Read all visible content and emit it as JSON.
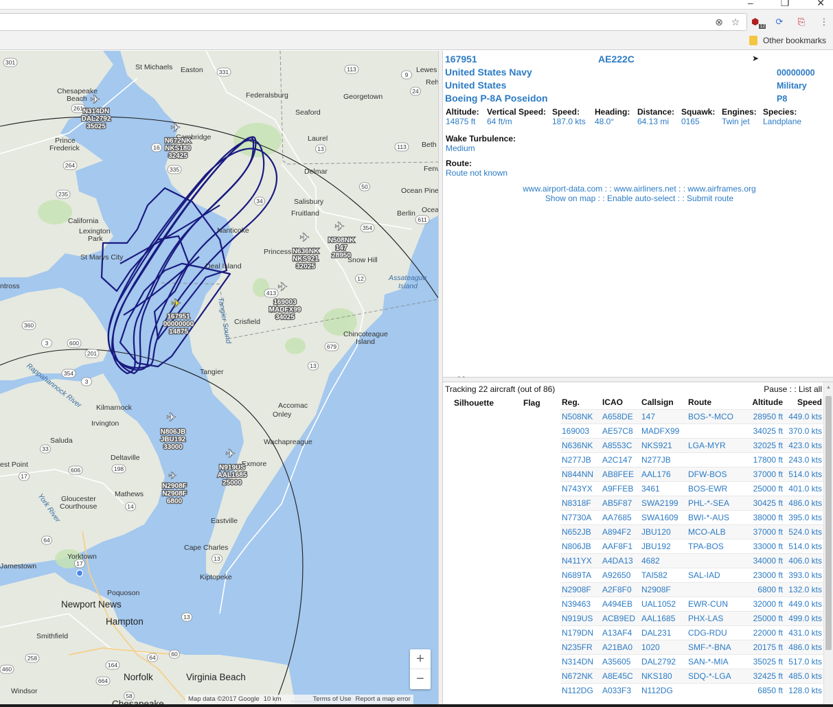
{
  "browser": {
    "other_bookmarks": "Other bookmarks",
    "ext_badge": "12",
    "window_buttons": [
      "–",
      "❐",
      "✕"
    ]
  },
  "aircraft": {
    "reg": "167951",
    "icao": "AE222C",
    "operator": "United States Navy",
    "squawk_code": "00000000",
    "country": "United States",
    "category": "Military",
    "type": "Boeing P-8A Poseidon",
    "type_code": "P8",
    "stats": [
      {
        "k": "Altitude:",
        "v": "14875 ft"
      },
      {
        "k": "Vertical Speed:",
        "v": "64 ft/m"
      },
      {
        "k": "Speed:",
        "v": "187.0 kts"
      },
      {
        "k": "Heading:",
        "v": "48.0°"
      },
      {
        "k": "Distance:",
        "v": "64.13 mi"
      },
      {
        "k": "Squawk:",
        "v": "0165"
      },
      {
        "k": "Engines:",
        "v": "Twin jet"
      },
      {
        "k": "Species:",
        "v": "Landplane"
      }
    ],
    "wake_label": "Wake Turbulence:",
    "wake_value": "Medium",
    "route_label": "Route:",
    "route_value": "Route not known",
    "links1": [
      "www.airport-data.com",
      "www.airliners.net",
      "www.airframes.org"
    ],
    "links2": [
      "Show on map",
      "Enable auto-select",
      "Submit route"
    ],
    "sep": " : : "
  },
  "tracking": {
    "summary": "Tracking 22 aircraft (out of 86)",
    "pause": "Pause",
    "list_all": "List all",
    "columns": [
      "Silhouette",
      "Flag",
      "Reg.",
      "ICAO",
      "Callsign",
      "Route",
      "Altitude",
      "Speed"
    ],
    "rows": [
      [
        "N508NK",
        "A658DE",
        "147",
        "BOS-*-MCO",
        "28950 ft",
        "449.0 kts"
      ],
      [
        "169003",
        "AE57C8",
        "MADFX99",
        "",
        "34025 ft",
        "370.0 kts"
      ],
      [
        "N636NK",
        "A8553C",
        "NKS921",
        "LGA-MYR",
        "32025 ft",
        "423.0 kts"
      ],
      [
        "N277JB",
        "A2C147",
        "N277JB",
        "",
        "17800 ft",
        "243.0 kts"
      ],
      [
        "N844NN",
        "AB8FEE",
        "AAL176",
        "DFW-BOS",
        "37000 ft",
        "514.0 kts"
      ],
      [
        "N743YX",
        "A9FFEB",
        "3461",
        "BOS-EWR",
        "25000 ft",
        "401.0 kts"
      ],
      [
        "N8318F",
        "AB5F87",
        "SWA2199",
        "PHL-*-SEA",
        "30425 ft",
        "486.0 kts"
      ],
      [
        "N7730A",
        "AA7685",
        "SWA1609",
        "BWI-*-AUS",
        "38000 ft",
        "395.0 kts"
      ],
      [
        "N652JB",
        "A894F2",
        "JBU120",
        "MCO-ALB",
        "37000 ft",
        "524.0 kts"
      ],
      [
        "N806JB",
        "AAF8F1",
        "JBU192",
        "TPA-BOS",
        "33000 ft",
        "514.0 kts"
      ],
      [
        "N411YX",
        "A4DA13",
        "4682",
        "",
        "34000 ft",
        "406.0 kts"
      ],
      [
        "N689TA",
        "A92650",
        "TAI582",
        "SAL-IAD",
        "23000 ft",
        "393.0 kts"
      ],
      [
        "N2908F",
        "A2F8F0",
        "N2908F",
        "",
        "6800 ft",
        "132.0 kts"
      ],
      [
        "N39463",
        "A494EB",
        "UAL1052",
        "EWR-CUN",
        "32000 ft",
        "449.0 kts"
      ],
      [
        "N919US",
        "ACB9ED",
        "AAL1685",
        "PHX-LAS",
        "25000 ft",
        "499.0 kts"
      ],
      [
        "N179DN",
        "A13AF4",
        "DAL231",
        "CDG-RDU",
        "22000 ft",
        "431.0 kts"
      ],
      [
        "N235FR",
        "A21BA0",
        "1020",
        "SMF-*-BNA",
        "20175 ft",
        "486.0 kts"
      ],
      [
        "N314DN",
        "A35605",
        "DAL2792",
        "SAN-*-MIA",
        "35025 ft",
        "517.0 kts"
      ],
      [
        "N672NK",
        "A8E45C",
        "NKS180",
        "SDQ-*-LGA",
        "32425 ft",
        "485.0 kts"
      ],
      [
        "N112DG",
        "A033F3",
        "N112DG",
        "",
        "6850 ft",
        "128.0 kts"
      ]
    ]
  },
  "map": {
    "places": [
      {
        "t": "St Michaels"
      },
      {
        "t": "Easton"
      },
      {
        "t": "Chesapeake"
      },
      {
        "t": "Beach"
      },
      {
        "t": "Federalsburg"
      },
      {
        "t": "Georgetown"
      },
      {
        "t": "Seaford"
      },
      {
        "t": "Laurel"
      },
      {
        "t": "Delmar"
      },
      {
        "t": "Salisbury"
      },
      {
        "t": "Fruitland"
      },
      {
        "t": "Berlin"
      },
      {
        "t": "Ocean Pine"
      },
      {
        "t": "Prince"
      },
      {
        "t": "Frederick"
      },
      {
        "t": "California"
      },
      {
        "t": "Lexington"
      },
      {
        "t": "Park"
      },
      {
        "t": "St Marys City"
      },
      {
        "t": "Princess Anne"
      },
      {
        "t": "Nanticoke"
      },
      {
        "t": "Deal Island"
      },
      {
        "t": "Snow Hill"
      },
      {
        "t": "Crisfield"
      },
      {
        "t": "Tangier"
      },
      {
        "t": "Chincoteague"
      },
      {
        "t": "Island"
      },
      {
        "t": "Kilmarnock"
      },
      {
        "t": "Irvington"
      },
      {
        "t": "Saluda"
      },
      {
        "t": "Deltaville"
      },
      {
        "t": "Accomac"
      },
      {
        "t": "Onley"
      },
      {
        "t": "Wachapreague"
      },
      {
        "t": "Exmore"
      },
      {
        "t": "Mathews"
      },
      {
        "t": "Gloucester"
      },
      {
        "t": "Courthouse"
      },
      {
        "t": "Eastville"
      },
      {
        "t": "Cape Charles"
      },
      {
        "t": "Kiptopeke"
      },
      {
        "t": "Yorktown"
      },
      {
        "t": "Jamestown"
      },
      {
        "t": "Poquoson"
      },
      {
        "t": "Newport News"
      },
      {
        "t": "Hampton"
      },
      {
        "t": "Smithfield"
      },
      {
        "t": "Norfolk"
      },
      {
        "t": "Virginia Beach"
      },
      {
        "t": "Windsor"
      },
      {
        "t": "Chesapeake"
      },
      {
        "t": "ntross"
      },
      {
        "t": "est Point"
      },
      {
        "t": "Cambridge"
      },
      {
        "t": "Lewes"
      },
      {
        "t": "Beth"
      },
      {
        "t": "Fenv"
      },
      {
        "t": "Ocea"
      },
      {
        "t": "Reh"
      }
    ],
    "water": [
      "Assateague",
      "Island",
      "Rappahannock River",
      "York River",
      "Tangier Sound"
    ],
    "aircraft_labels": [
      [
        "N314DN",
        "DAL2792",
        "35025"
      ],
      [
        "N672NK",
        "NKS180",
        "32425"
      ],
      [
        "N508NK",
        "147",
        "28950"
      ],
      [
        "N636NK",
        "NKS921",
        "32025"
      ],
      [
        "169003",
        "MADFX99",
        "34025"
      ],
      [
        "167951",
        "00000000",
        "14875"
      ],
      [
        "N806JB",
        "JBU192",
        "33000"
      ],
      [
        "N919US",
        "AAL1685",
        "25000"
      ],
      [
        "N2908F",
        "N2908F",
        "6800"
      ]
    ],
    "shields": [
      "301",
      "331",
      "113",
      "9",
      "24",
      "261",
      "16",
      "335",
      "13",
      "113",
      "264",
      "235",
      "50",
      "34",
      "611",
      "354",
      "12",
      "413",
      "679",
      "360",
      "3",
      "600",
      "201",
      "354",
      "3",
      "33",
      "13",
      "17",
      "606",
      "198",
      "14",
      "64",
      "17",
      "13",
      "13",
      "60",
      "64",
      "164",
      "258",
      "460",
      "664",
      "58"
    ],
    "zoom_in": "+",
    "zoom_out": "−",
    "attribution": [
      "Map data ©2017 Google",
      "10 km",
      "Terms of Use",
      "Report a map error"
    ]
  }
}
